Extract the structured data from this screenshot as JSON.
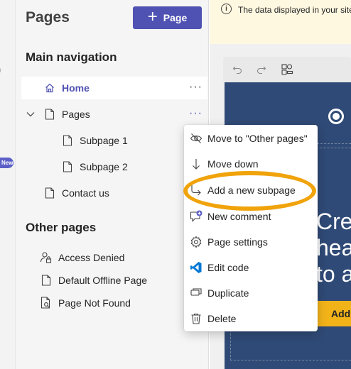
{
  "left_strip": {
    "items": [
      {
        "label": "s"
      },
      {
        "label": "ng"
      },
      {
        "label": "o"
      },
      {
        "label": "p"
      },
      {
        "label": "New"
      },
      {
        "label": "ty"
      }
    ]
  },
  "pages_panel": {
    "title": "Pages",
    "add_button_label": "Page",
    "main_nav_title": "Main navigation",
    "main_items": [
      {
        "label": "Home"
      },
      {
        "label": "Pages"
      },
      {
        "label": "Subpage 1"
      },
      {
        "label": "Subpage 2"
      },
      {
        "label": "Contact us"
      }
    ],
    "more_label": "···",
    "other_title": "Other pages",
    "other_items": [
      {
        "label": "Access Denied"
      },
      {
        "label": "Default Offline Page"
      },
      {
        "label": "Page Not Found"
      }
    ]
  },
  "banner": {
    "info_glyph": "i",
    "text": "The data displayed in your site"
  },
  "preview": {
    "hero_lines": [
      "Cre",
      "hea",
      "to a"
    ],
    "button_label": "Add"
  },
  "context_menu": {
    "items": [
      {
        "label": "Move to \"Other pages\""
      },
      {
        "label": "Move down"
      },
      {
        "label": "Add a new subpage"
      },
      {
        "label": "New comment"
      },
      {
        "label": "Page settings"
      },
      {
        "label": "Edit code"
      },
      {
        "label": "Duplicate"
      },
      {
        "label": "Delete"
      }
    ]
  },
  "colors": {
    "accent": "#4f52b2",
    "highlight": "#f0a30a",
    "preview_bg": "#2f4a76",
    "banner_bg": "#fff8e1",
    "hero_button": "#f2b319",
    "vscode_blue": "#0078d4"
  }
}
